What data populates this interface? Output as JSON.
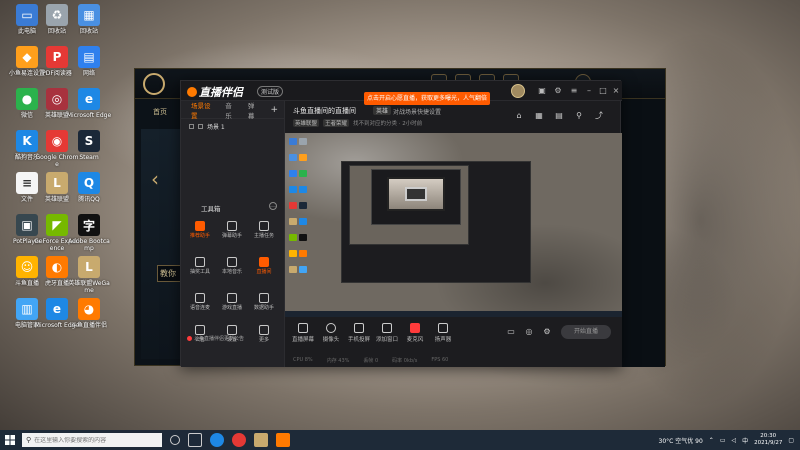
{
  "desktop": {
    "icons": [
      {
        "label": "此电脑",
        "color": "#3a7bd5",
        "glyph": "▭"
      },
      {
        "label": "回收站",
        "color": "#9aa4ad",
        "glyph": "♻"
      },
      {
        "label": "回收站",
        "color": "#4a90e2",
        "glyph": "▦"
      },
      {
        "label": "小鱼易连设置",
        "color": "#ff9f1c",
        "glyph": "◆"
      },
      {
        "label": "PDF阅读器",
        "color": "#e53935",
        "glyph": "P"
      },
      {
        "label": "网络",
        "color": "#2f80ed",
        "glyph": "▤"
      },
      {
        "label": "微信",
        "color": "#2bb24c",
        "glyph": "●"
      },
      {
        "label": "英雄联盟",
        "color": "#a8323e",
        "glyph": "◎"
      },
      {
        "label": "Microsoft Edge",
        "color": "#1e88e5",
        "glyph": "e"
      },
      {
        "label": "酷狗音乐",
        "color": "#1e88e5",
        "glyph": "K"
      },
      {
        "label": "Google Chrome",
        "color": "#e53935",
        "glyph": "◉"
      },
      {
        "label": "Steam",
        "color": "#1b2838",
        "glyph": "S"
      },
      {
        "label": "文件",
        "color": "#f5f5f5",
        "glyph": "≡"
      },
      {
        "label": "英雄联盟",
        "color": "#c8aa6e",
        "glyph": "L"
      },
      {
        "label": "腾讯QQ",
        "color": "#1e88e5",
        "glyph": "Q"
      },
      {
        "label": "PotPlayer",
        "color": "#37474f",
        "glyph": "▣"
      },
      {
        "label": "GeForce Experience",
        "color": "#76b900",
        "glyph": "◤"
      },
      {
        "label": "Adobe Bootcamp",
        "color": "#111111",
        "glyph": "字"
      },
      {
        "label": "斗鱼直播",
        "color": "#ffb300",
        "glyph": "☺"
      },
      {
        "label": "虎牙直播",
        "color": "#ff7a00",
        "glyph": "◐"
      },
      {
        "label": "英雄联盟WeGame",
        "color": "#c8aa6e",
        "glyph": "L"
      },
      {
        "label": "电脑管家",
        "color": "#42a5f5",
        "glyph": "▥"
      },
      {
        "label": "Microsoft Edge",
        "color": "#1e88e5",
        "glyph": "e"
      },
      {
        "label": "斗鱼直播伴侣",
        "color": "#ff7a00",
        "glyph": "◕"
      }
    ]
  },
  "lol_client": {
    "home_label": "首页",
    "teach_label": "教你",
    "right_note": "2021.9.27"
  },
  "app": {
    "brand": "直播伴侣",
    "beta": "测试版",
    "promo": "点击开启心愿直播，获取更多曝光，人气翻倍",
    "tabs": [
      "场景设置",
      "音乐",
      "弹幕"
    ],
    "plus": "+",
    "scene_name": "场景 1",
    "tools_label": "工具箱",
    "tools_more": "…",
    "tools": [
      {
        "label": "推荐助手",
        "orange": true
      },
      {
        "label": "弹幕助手",
        "orange": false
      },
      {
        "label": "主播任务",
        "orange": false
      },
      {
        "label": "抽奖工具",
        "orange": false
      },
      {
        "label": "本地音乐",
        "orange": false
      },
      {
        "label": "直播间",
        "orange": true
      },
      {
        "label": "语音连麦",
        "orange": false
      },
      {
        "label": "游戏直播",
        "orange": false
      },
      {
        "label": "数据助手",
        "orange": false
      },
      {
        "label": "公告",
        "orange": false
      },
      {
        "label": "设置",
        "orange": false
      },
      {
        "label": "更多",
        "orange": false
      }
    ],
    "notice": "斗鱼直播伴侣更新公告",
    "room_title": "斗鱼直播间的直播间",
    "room_category": "英雄",
    "room_subtitle": "对战场景快捷设置",
    "room_tags": [
      "英雄联盟",
      "王者荣耀"
    ],
    "room_meta": "找不到对应的分类 · 2小时前",
    "bottom_tools": [
      {
        "label": "直播屏幕"
      },
      {
        "label": "摄像头"
      },
      {
        "label": "手机投屏"
      },
      {
        "label": "添加窗口"
      },
      {
        "label": "麦克风"
      },
      {
        "label": "扬声器"
      }
    ],
    "start_button": "开始直播",
    "status": [
      "CPU 8%",
      "内存 43%",
      "丢帧 0",
      "码率 0kb/s",
      "FPS 60"
    ]
  },
  "taskbar": {
    "search_placeholder": "在这里输入你要搜索的内容",
    "temp": "30°C 空气优 90",
    "time": "20:30",
    "date": "2021/9/27",
    "lang": "中"
  }
}
